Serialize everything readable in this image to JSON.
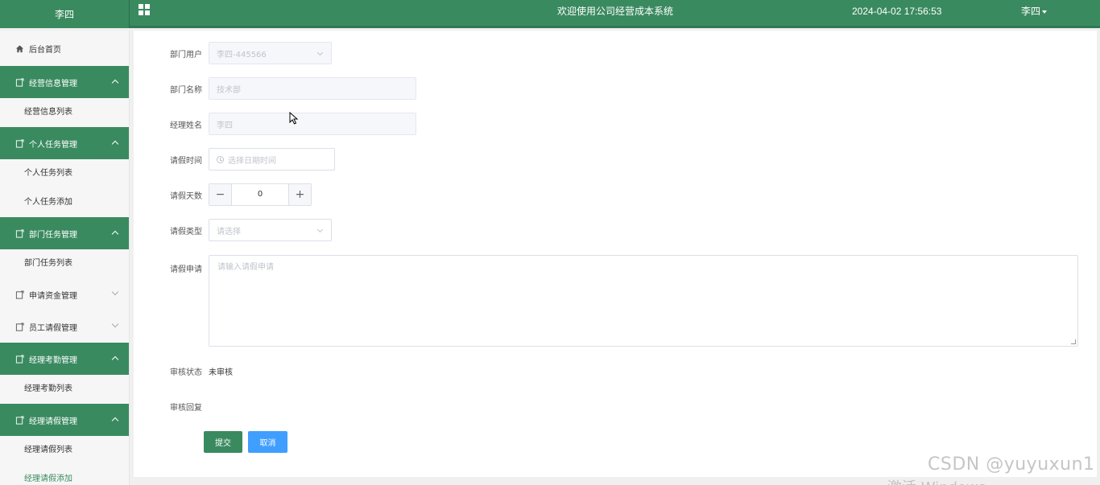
{
  "header": {
    "brand": "李四",
    "welcome": "欢迎使用公司经营成本系统",
    "datetime": "2024-04-02 17:56:53",
    "user": "李四"
  },
  "sidebar": {
    "home": "后台首页",
    "groups": [
      {
        "label": "经营信息管理",
        "items": [
          "经营信息列表"
        ]
      },
      {
        "label": "个人任务管理",
        "items": [
          "个人任务列表",
          "个人任务添加"
        ]
      },
      {
        "label": "部门任务管理",
        "items": [
          "部门任务列表"
        ]
      },
      {
        "label": "申请资金管理",
        "items": []
      },
      {
        "label": "员工请假管理",
        "items": []
      },
      {
        "label": "经理考勤管理",
        "items": [
          "经理考勤列表"
        ]
      },
      {
        "label": "经理请假管理",
        "items": [
          "经理请假列表",
          "经理请假添加"
        ]
      }
    ]
  },
  "form": {
    "dept_user_label": "部门用户",
    "dept_user_value": "李四-445566",
    "dept_name_label": "部门名称",
    "dept_name_value": "技术部",
    "manager_name_label": "经理姓名",
    "manager_name_value": "李四",
    "leave_time_label": "请假时间",
    "leave_time_placeholder": "选择日期时间",
    "leave_days_label": "请假天数",
    "leave_days_value": "0",
    "minus": "−",
    "plus": "+",
    "leave_type_label": "请假类型",
    "leave_type_placeholder": "请选择",
    "leave_apply_label": "请假申请",
    "leave_apply_placeholder": "请输入请假申请",
    "review_status_label": "审核状态",
    "review_status_value": "未审核",
    "review_reply_label": "审核回复",
    "submit": "提交",
    "cancel": "取消"
  },
  "watermark": {
    "csdn": "CSDN @yuyuxun1",
    "windows": "激活 Windows"
  }
}
